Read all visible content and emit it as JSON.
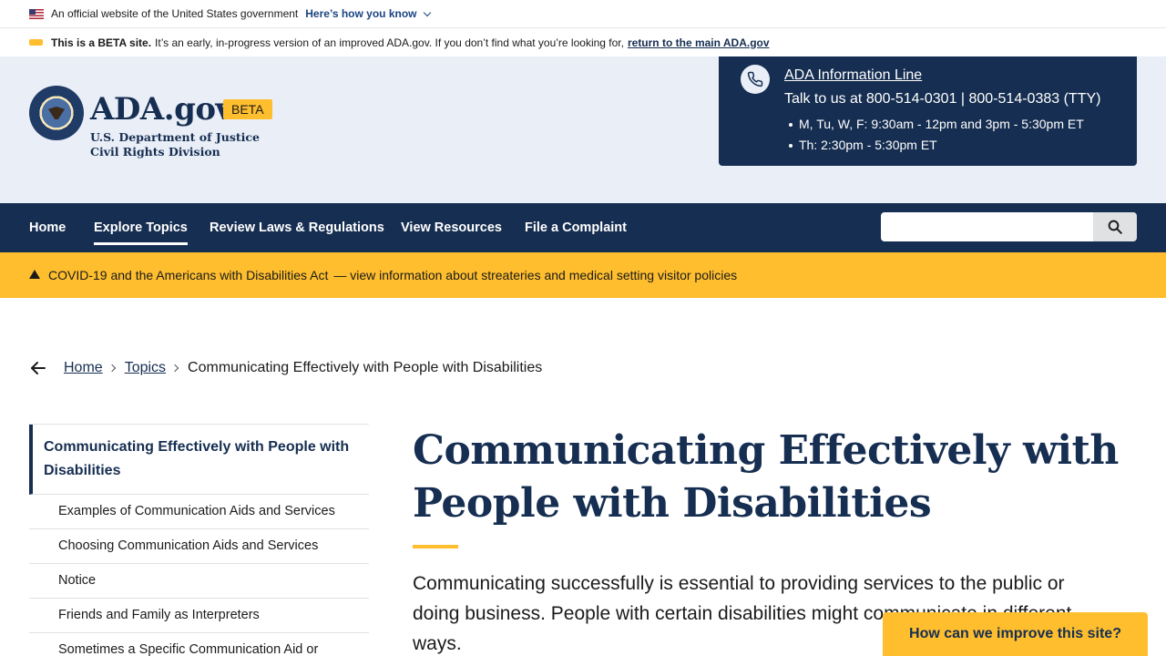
{
  "gov_banner": {
    "text": "An official website of the United States government",
    "link": "Here’s how you know"
  },
  "beta_banner": {
    "bold": "This is a BETA site.",
    "text": "It’s an early, in-progress version of an improved ADA.gov. If you don’t find what you’re looking for,",
    "link": "return to the main ADA.gov"
  },
  "header": {
    "logo": "ADA.gov",
    "beta_tag": "BETA",
    "dept_line1": "U.S. Department of Justice",
    "dept_line2": "Civil Rights Division"
  },
  "info_line": {
    "title": "ADA Information Line",
    "phone": "Talk to us at 800-514-0301 | 800-514-0383 (TTY)",
    "hours": [
      "M, Tu, W, F: 9:30am - 12pm and 3pm - 5:30pm ET",
      "Th: 2:30pm - 5:30pm ET"
    ]
  },
  "nav": {
    "items": [
      "Home",
      "Explore Topics",
      "Review Laws & Regulations",
      "View Resources",
      "File a Complaint"
    ],
    "active": "Explore Topics",
    "search_placeholder": ""
  },
  "alert": {
    "title": "COVID-19 and the Americans with Disabilities Act",
    "text": "— view information about streateries and medical setting visitor policies"
  },
  "breadcrumb": {
    "items": [
      "Home",
      "Topics"
    ],
    "current": "Communicating Effectively with People with Disabilities"
  },
  "sidenav": {
    "current": "Communicating Effectively with People with Disabilities",
    "items": [
      "Examples of Communication Aids and Services",
      "Choosing Communication Aids and Services",
      "Notice",
      "Friends and Family as Interpreters",
      "Sometimes a Specific Communication Aid or"
    ]
  },
  "main": {
    "title": "Communicating Effectively with People with Disabilities",
    "intro": "Communicating successfully is essential to providing services to the public or doing business. People with certain disabilities might communicate in different ways."
  },
  "feedback_button": "How can we improve this site?",
  "colors": {
    "navy": "#162e51",
    "gold": "#ffbe2e",
    "header_bg": "#e9eef7"
  }
}
